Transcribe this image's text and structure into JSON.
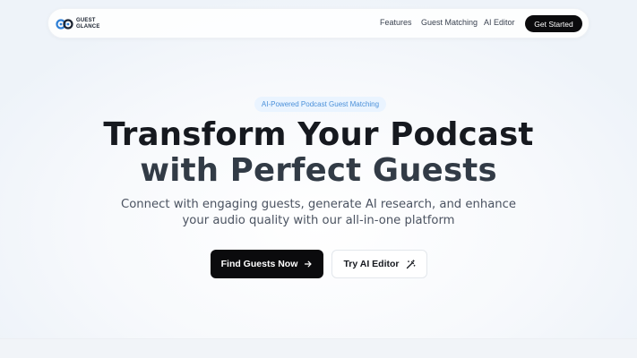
{
  "navbar": {
    "logo_line1": "GUEST",
    "logo_line2": "GLANCE",
    "links": [
      "Features",
      "Guest Matching",
      "AI Editor"
    ],
    "cta_label": "Get Started"
  },
  "hero": {
    "badge": "AI-Powered Podcast Guest Matching",
    "headline_line1": "Transform Your Podcast",
    "headline_line2": "with Perfect Guests",
    "subtitle_line1": "Connect with engaging guests, generate AI research, and enhance",
    "subtitle_line2": "your audio quality with our all-in-one platform",
    "primary_button": "Find Guests Now",
    "primary_icon": "arrow-right-icon",
    "secondary_button": "Try AI Editor",
    "secondary_icon": "magic-wand-icon"
  },
  "colors": {
    "accent_dark": "#0b0b0d",
    "badge_bg": "#eaf4ff",
    "badge_text": "#4a90d9",
    "logo_blue": "#2f80d6"
  }
}
